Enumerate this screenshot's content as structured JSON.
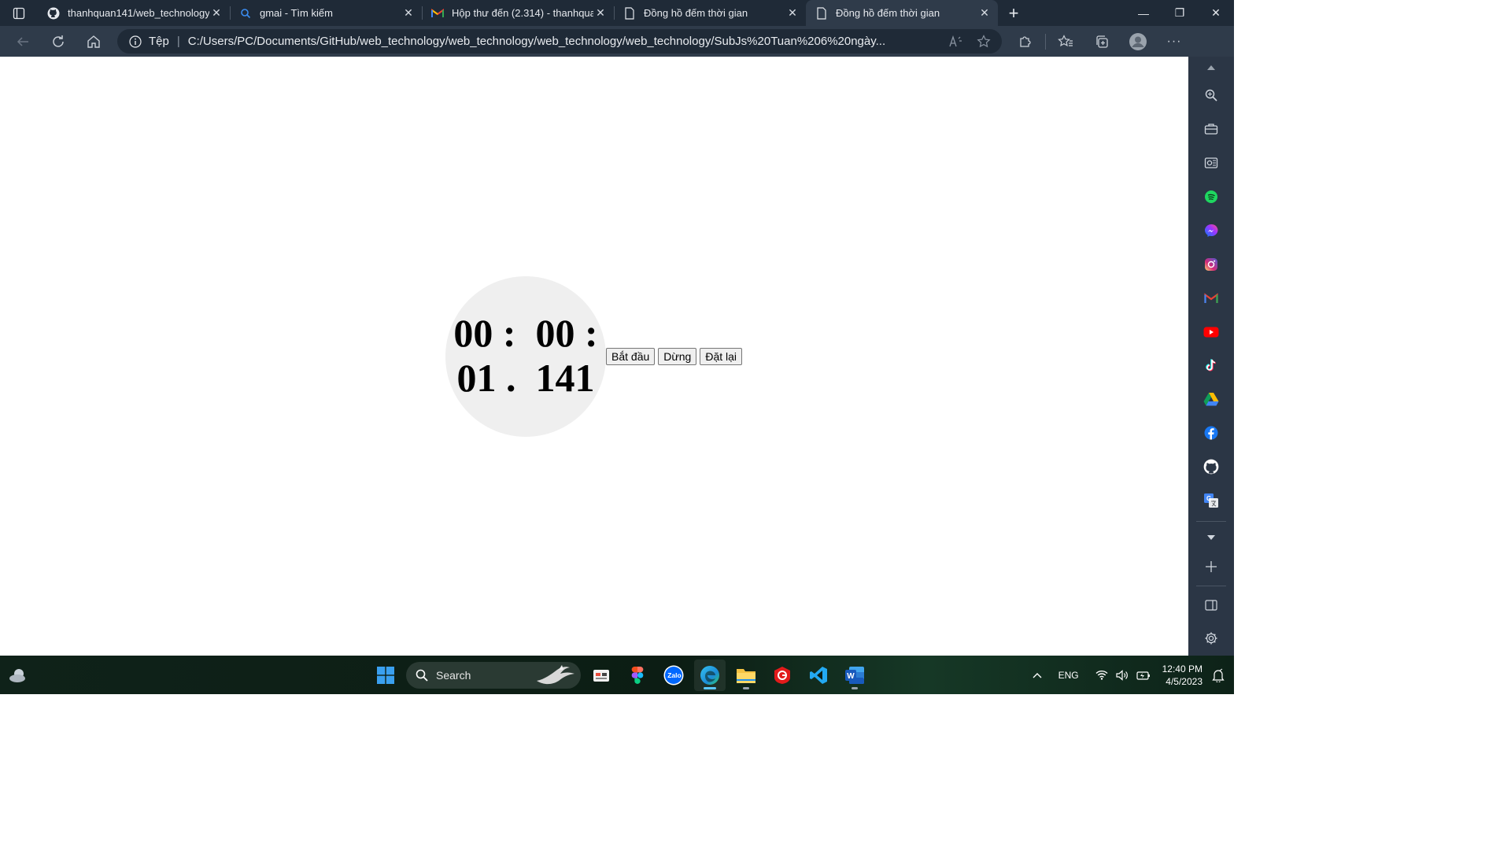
{
  "browser": {
    "tabs": [
      {
        "title": "thanhquan141/web_technology",
        "icon": "github-icon"
      },
      {
        "title": "gmai - Tìm kiếm",
        "icon": "search-icon"
      },
      {
        "title": "Hộp thư đến (2.314) - thanhquan",
        "icon": "gmail-icon"
      },
      {
        "title": "Đồng hồ đếm thời gian",
        "icon": "page-icon"
      },
      {
        "title": "Đồng hồ đếm thời gian",
        "icon": "page-icon",
        "active": true
      }
    ],
    "address": {
      "scheme": "Tệp",
      "url": "C:/Users/PC/Documents/GitHub/web_technology/web_technology/web_technology/web_technology/SubJs%20Tuan%206%20ngày..."
    }
  },
  "stopwatch": {
    "line1": "00 :  00 :",
    "line2": "01 .  141",
    "buttons": {
      "start": "Bắt đầu",
      "stop": "Dừng",
      "reset": "Đặt lại"
    },
    "circle_color": "#efefef"
  },
  "sidebar": {
    "items": [
      "search-icon",
      "tools-icon",
      "outlook-icon",
      "spotify-icon",
      "messenger-icon",
      "instagram-icon",
      "gmail-icon",
      "youtube-icon",
      "tiktok-icon",
      "drive-icon",
      "facebook-icon",
      "github-icon",
      "translate-icon"
    ]
  },
  "taskbar": {
    "search_label": "Search",
    "language": "ENG",
    "time": "12:40 PM",
    "date": "4/5/2023"
  },
  "colors": {
    "tabstrip": "#1f2a37",
    "toolbar": "#2f3b4a",
    "sidebar": "#2b3645",
    "accent": "#5bc8ff"
  }
}
